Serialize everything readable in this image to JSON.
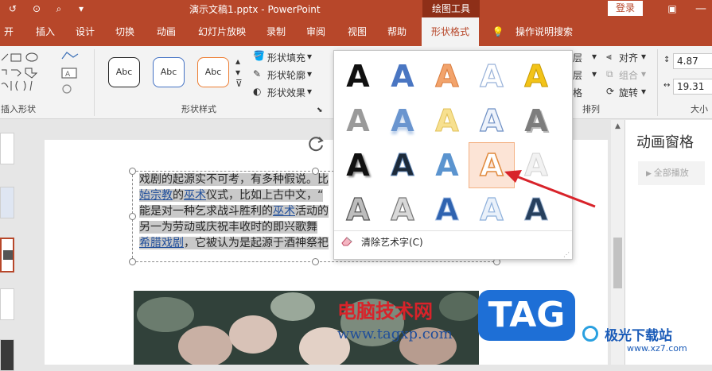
{
  "titlebar": {
    "doc_title": "演示文稿1.pptx  -  PowerPoint",
    "context_tab": "绘图工具",
    "login": "登录"
  },
  "tabs": [
    {
      "label": "开始"
    },
    {
      "label": "插入"
    },
    {
      "label": "设计"
    },
    {
      "label": "切换"
    },
    {
      "label": "动画"
    },
    {
      "label": "幻灯片放映"
    },
    {
      "label": "录制"
    },
    {
      "label": "审阅"
    },
    {
      "label": "视图"
    },
    {
      "label": "帮助"
    },
    {
      "label": "形状格式"
    },
    {
      "label": "操作说明搜索"
    }
  ],
  "ribbon": {
    "insert_shapes_label": "插入形状",
    "shape_styles_label": "形状样式",
    "style_sample": "Abc",
    "fill": "形状填充",
    "outline": "形状轮廓",
    "effects": "形状效果",
    "arrange_label": "排列",
    "layer1": "层",
    "layer2": "层",
    "pane": "格",
    "align": "对齐",
    "group": "组合",
    "rotate": "旋转",
    "height": "4.87",
    "width": "19.31",
    "size_label": "大小"
  },
  "gallery": {
    "letter": "A",
    "clear": "清除艺术字(C)"
  },
  "textbox": {
    "line1": "戏剧的起源实不可考，有多种假说。比",
    "line2a": "始宗教",
    "line2b": "的",
    "line2c": "巫术",
    "line2d": "仪式，比如上古中文，“",
    "line3a": "能是对一种乞求战斗胜利的",
    "line3b": "巫术",
    "line3c": "活动的",
    "line4": "另一为劳动或庆祝丰收时的即兴歌舞",
    "line5a": "希腊戏剧",
    "line5b": "，它被认为是起源于酒神祭祀"
  },
  "anim_pane": {
    "title": "动画窗格",
    "play_all": "全部播放"
  },
  "watermark": {
    "site_cn": "电脑技术网",
    "site_url": "www.tagxp.com",
    "tag": "TAG",
    "brand": "极光下载站",
    "brand_url": "www.xz7.com"
  },
  "colors": {
    "ppt_red": "#b7472a",
    "link": "#1f4e9b",
    "tag_blue": "#1e6fd6",
    "arrow_red": "#d8232a"
  }
}
